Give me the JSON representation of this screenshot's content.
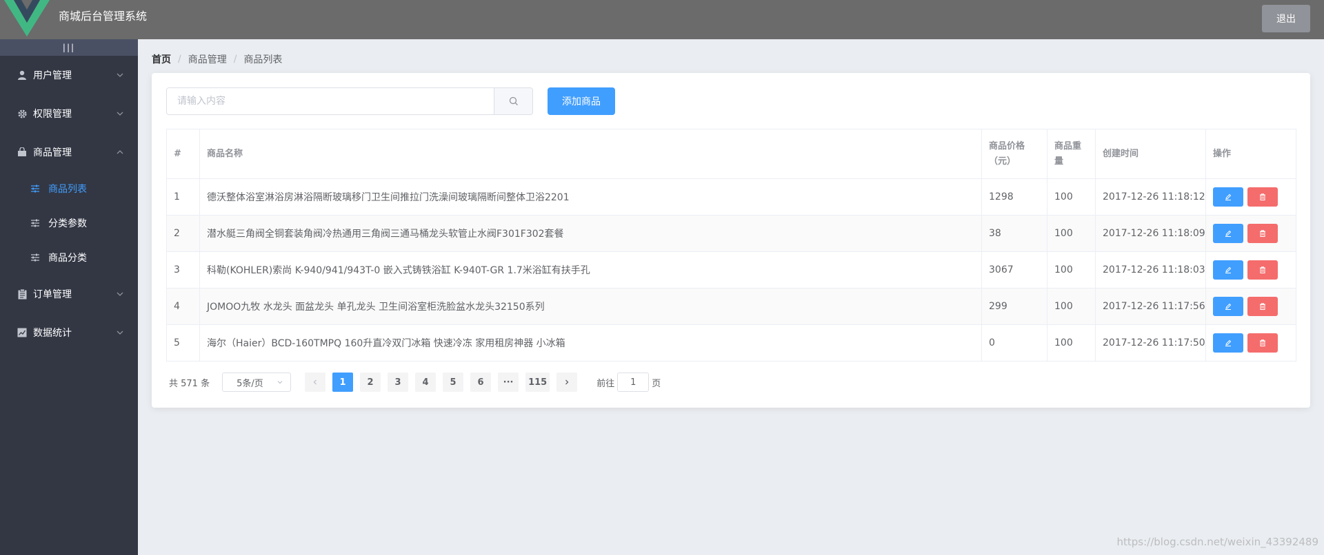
{
  "header": {
    "title": "商城后台管理系统",
    "logout_label": "退出"
  },
  "sidebar": {
    "toggle_label": "|||",
    "items": [
      {
        "label": "用户管理",
        "icon": "user-icon"
      },
      {
        "label": "权限管理",
        "icon": "gear-icon"
      },
      {
        "label": "商品管理",
        "icon": "shopping-bag-icon",
        "expanded": true,
        "children": [
          {
            "label": "商品列表",
            "active": true
          },
          {
            "label": "分类参数"
          },
          {
            "label": "商品分类"
          }
        ]
      },
      {
        "label": "订单管理",
        "icon": "clipboard-icon"
      },
      {
        "label": "数据统计",
        "icon": "chart-icon"
      }
    ]
  },
  "breadcrumb": [
    "首页",
    "商品管理",
    "商品列表"
  ],
  "search": {
    "placeholder": "请输入内容",
    "value": ""
  },
  "add_button_label": "添加商品",
  "table": {
    "headers": [
      "#",
      "商品名称",
      "商品价格（元）",
      "商品重量",
      "创建时间",
      "操作"
    ],
    "rows": [
      [
        "1",
        "德沃整体浴室淋浴房淋浴隔断玻璃移门卫生间推拉门洗澡间玻璃隔断间整体卫浴2201",
        "1298",
        "100",
        "2017-12-26 11:18:12"
      ],
      [
        "2",
        "潜水艇三角阀全铜套装角阀冷热通用三角阀三通马桶龙头软管止水阀F301F302套餐",
        "38",
        "100",
        "2017-12-26 11:18:09"
      ],
      [
        "3",
        "科勒(KOHLER)索尚 K-940/941/943T-0 嵌入式铸铁浴缸 K-940T-GR 1.7米浴缸有扶手孔",
        "3067",
        "100",
        "2017-12-26 11:18:03"
      ],
      [
        "4",
        "JOMOO九牧 水龙头 面盆龙头 单孔龙头 卫生间浴室柜洗脸盆水龙头32150系列",
        "299",
        "100",
        "2017-12-26 11:17:56"
      ],
      [
        "5",
        "海尔（Haier）BCD-160TMPQ 160升直冷双门冰箱 快速冷冻 家用租房神器 小冰箱",
        "0",
        "100",
        "2017-12-26 11:17:50"
      ]
    ]
  },
  "pagination": {
    "total_label": "共 571 条",
    "page_size_label": "5条/页",
    "pages": [
      "1",
      "2",
      "3",
      "4",
      "5",
      "6",
      "···",
      "115"
    ],
    "current": "1",
    "jump_prefix": "前往",
    "jump_value": "1",
    "jump_suffix": "页"
  },
  "colors": {
    "primary": "#409eff",
    "danger": "#f56c6c",
    "sidebar": "#333744",
    "header": "#6b6b6b"
  },
  "watermark": "https://blog.csdn.net/weixin_43392489"
}
